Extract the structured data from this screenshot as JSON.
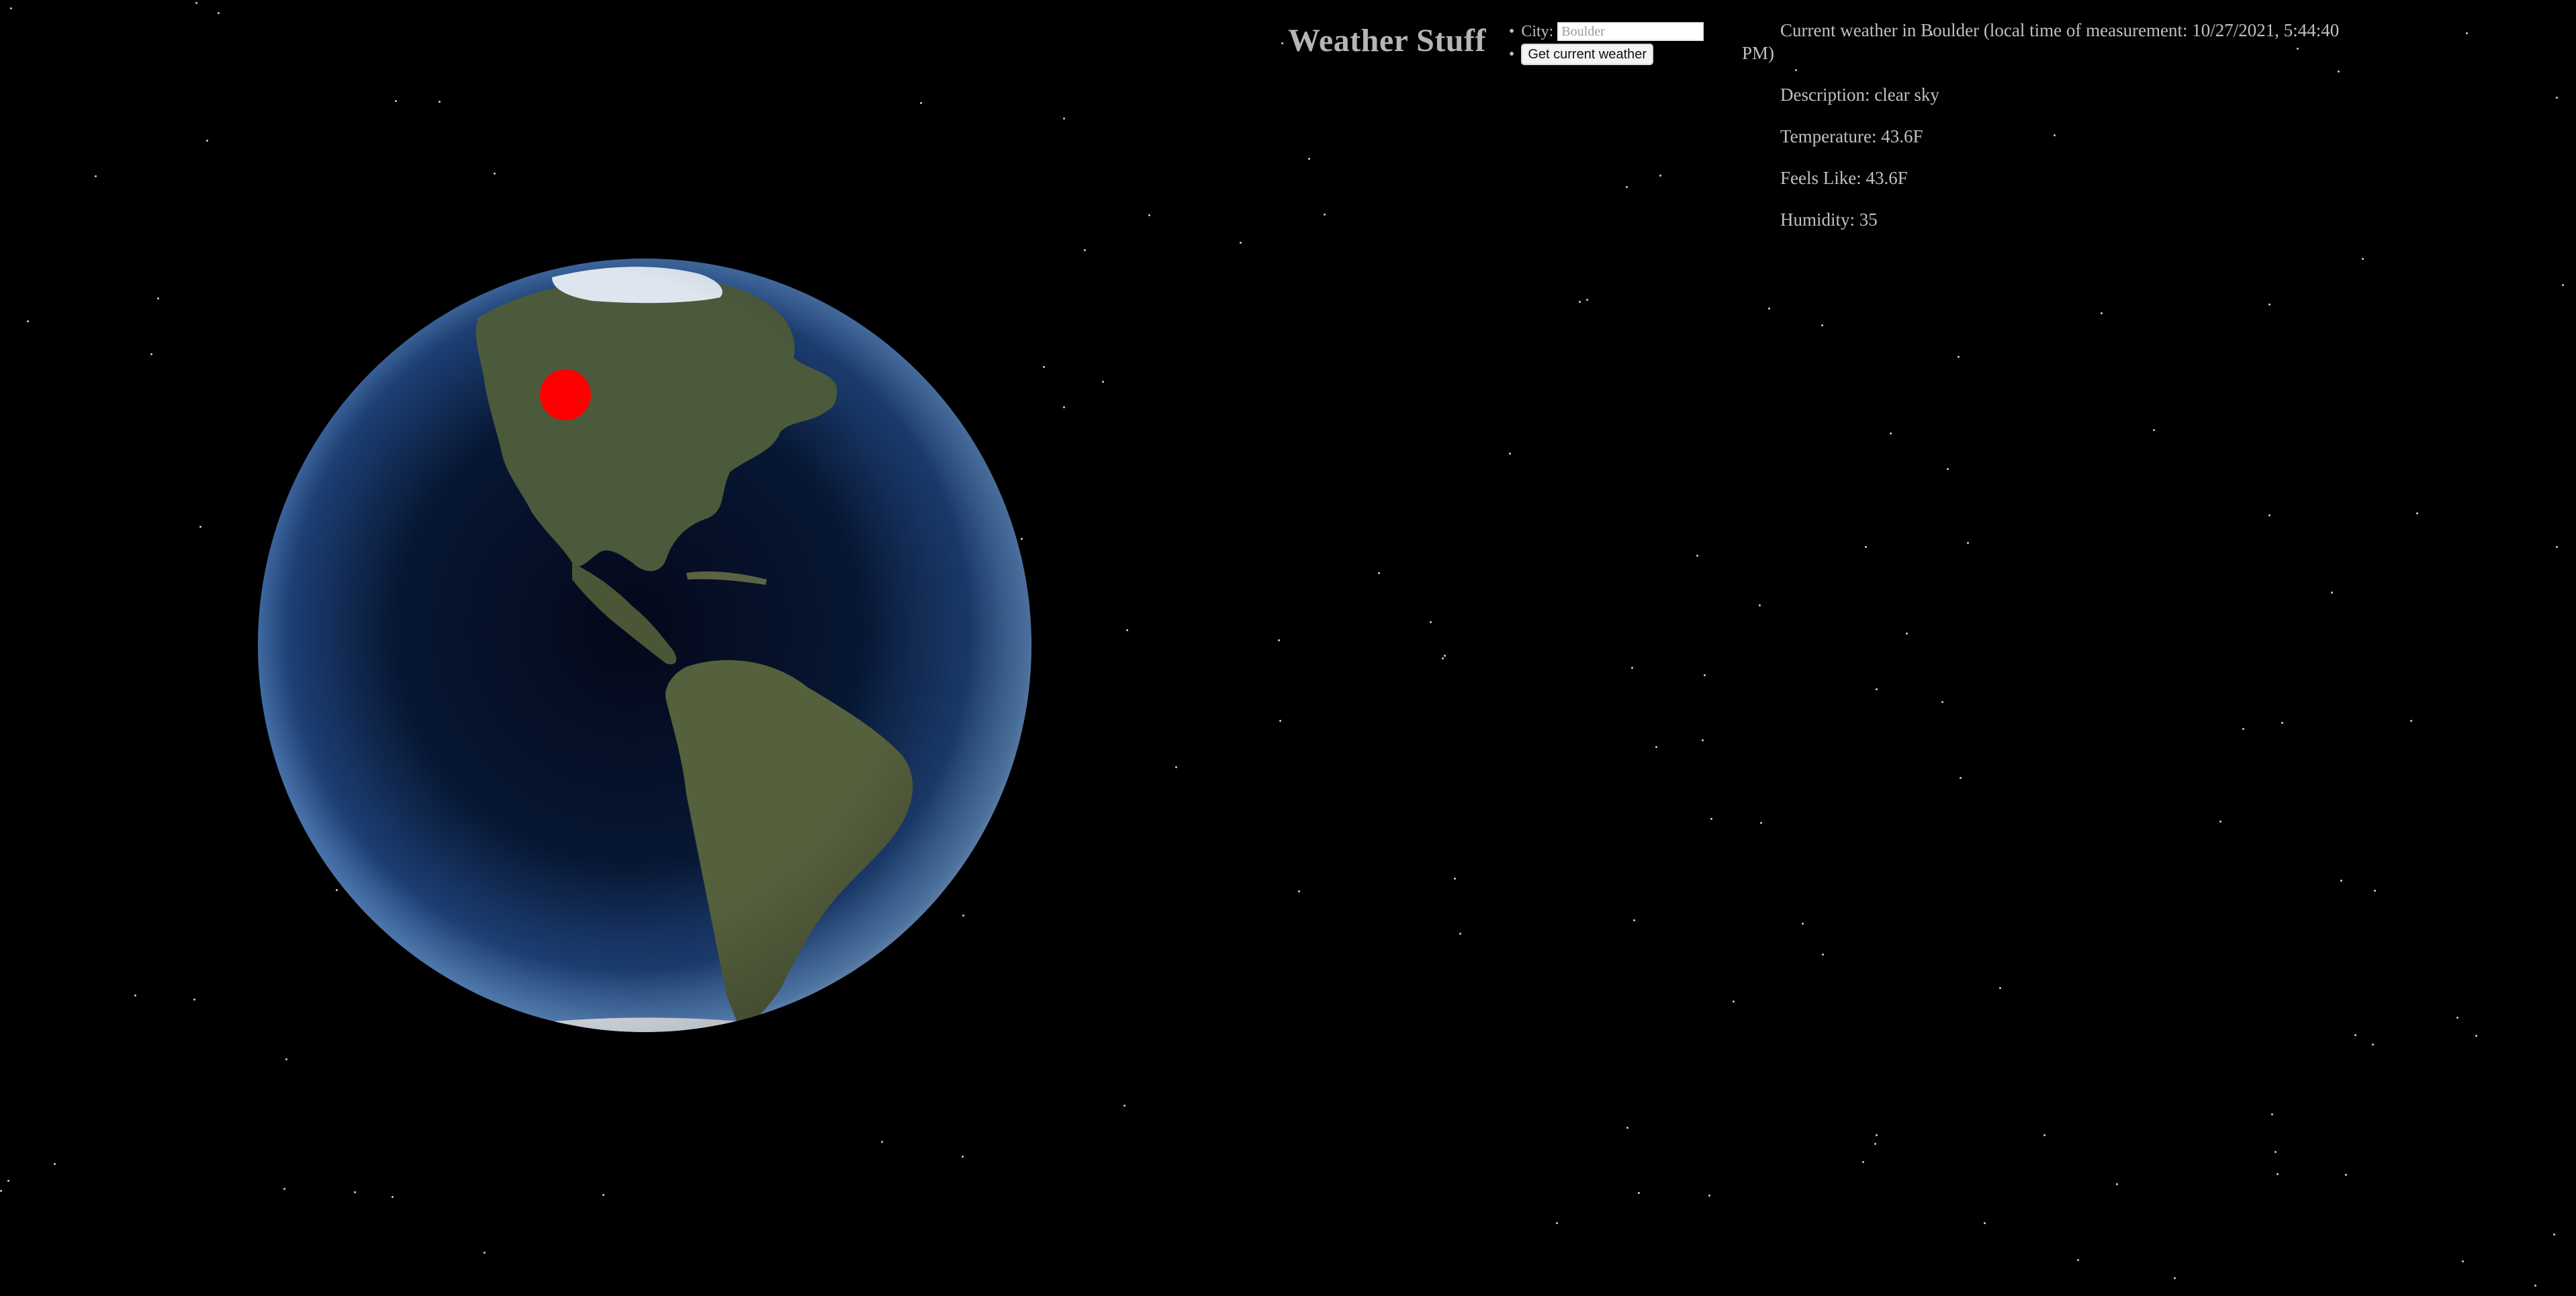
{
  "app": {
    "title": "Weather Stuff"
  },
  "form": {
    "city_label": "City:",
    "city_value": "",
    "city_placeholder": "Boulder",
    "submit_label": "Get current weather"
  },
  "weather": {
    "headline": "Current weather in Boulder (local time of measurement: 10/27/2021, 5:44:40 PM)",
    "description": "Description: clear sky",
    "temperature": "Temperature: 43.6F",
    "feels_like": "Feels Like: 43.6F",
    "humidity": "Humidity: 35"
  },
  "globe": {
    "marker_color": "#ff0000",
    "ocean_color": "#0b1b3a",
    "land_color": "#4b5a3a"
  }
}
